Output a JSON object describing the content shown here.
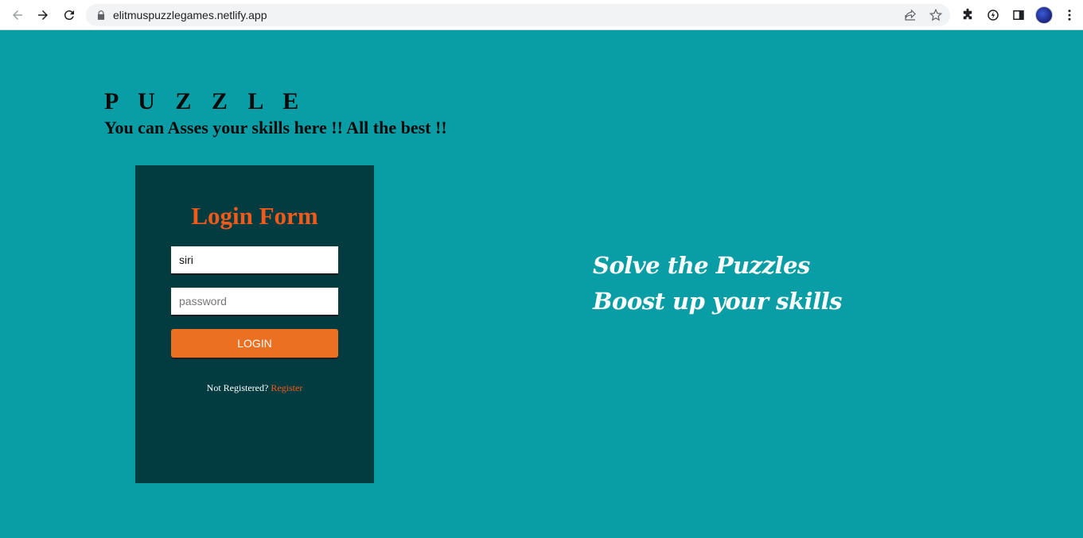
{
  "browser": {
    "url": "elitmuspuzzlegames.netlify.app",
    "icons": [
      "back-icon",
      "forward-icon",
      "reload-icon",
      "lock-icon",
      "share-icon",
      "star-icon",
      "extensions-icon",
      "sync-icon",
      "sidepanel-icon",
      "avatar",
      "menu-icon"
    ]
  },
  "page": {
    "title": "P U Z Z L E",
    "subtitle": "You can Asses your skills here !! All the best !!"
  },
  "login": {
    "heading": "Login Form",
    "username_value": "siri",
    "password_placeholder": "password",
    "button_label": "LOGIN",
    "register_prompt": "Not Registered?",
    "register_link": "Register"
  },
  "tagline": {
    "line1": "Solve the Puzzles",
    "line2": "Boost up your skills"
  },
  "colors": {
    "background": "#099ea6",
    "panel": "#023c40",
    "accent": "#f05a1a",
    "button": "#ec7022"
  }
}
